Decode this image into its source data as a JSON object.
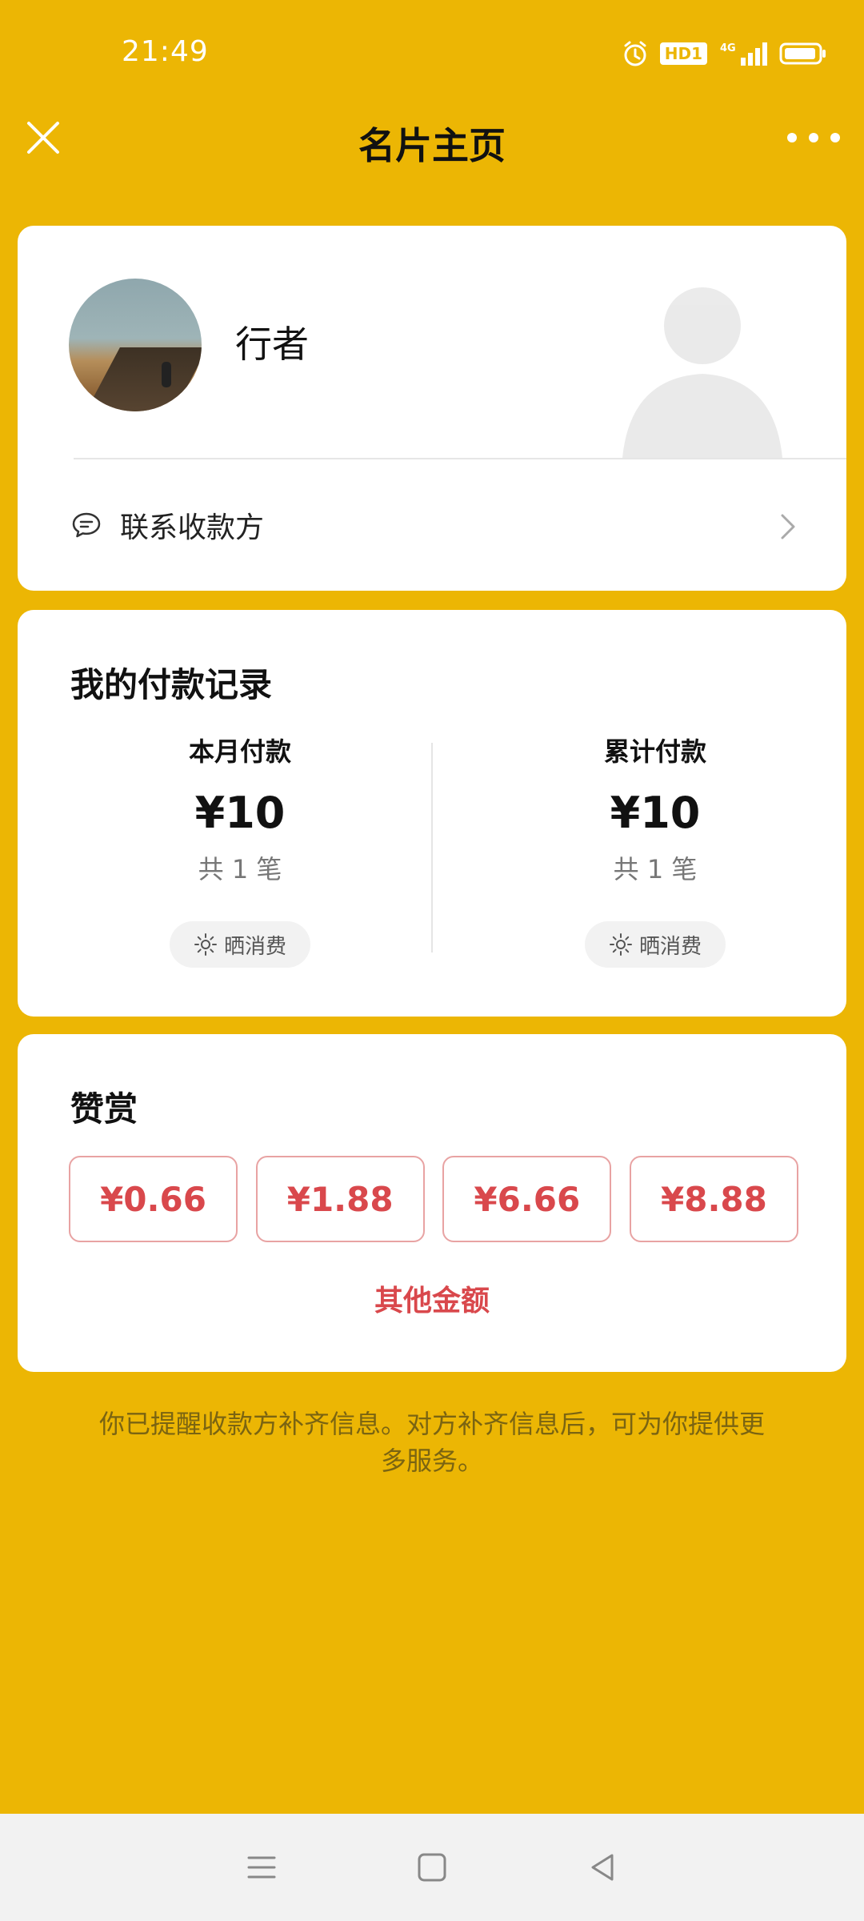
{
  "status_bar": {
    "time": "21:49",
    "hd_badge": "HD1",
    "network": "4G",
    "icons": [
      "alarm-icon",
      "hd-badge",
      "signal-icon",
      "battery-icon"
    ]
  },
  "header": {
    "title": "名片主页",
    "close_icon": "close-icon",
    "more_icon": "more-icon"
  },
  "profile": {
    "name": "行者",
    "contact_label": "联系收款方"
  },
  "records": {
    "title": "我的付款记录",
    "month": {
      "label": "本月付款",
      "amount": "¥10",
      "count": "共 1 笔",
      "share_label": "晒消费"
    },
    "total": {
      "label": "累计付款",
      "amount": "¥10",
      "count": "共 1 笔",
      "share_label": "晒消费"
    }
  },
  "reward": {
    "title": "赞赏",
    "amounts": [
      "¥0.66",
      "¥1.88",
      "¥6.66",
      "¥8.88"
    ],
    "other_label": "其他金额"
  },
  "footer_note": "你已提醒收款方补齐信息。对方补齐信息后，可为你提供更多服务。",
  "colors": {
    "background": "#ECB604",
    "accent_red": "#D9484C",
    "card": "#FFFFFF"
  },
  "nav_bar": {
    "icons": [
      "menu-icon",
      "home-icon",
      "back-icon"
    ]
  }
}
